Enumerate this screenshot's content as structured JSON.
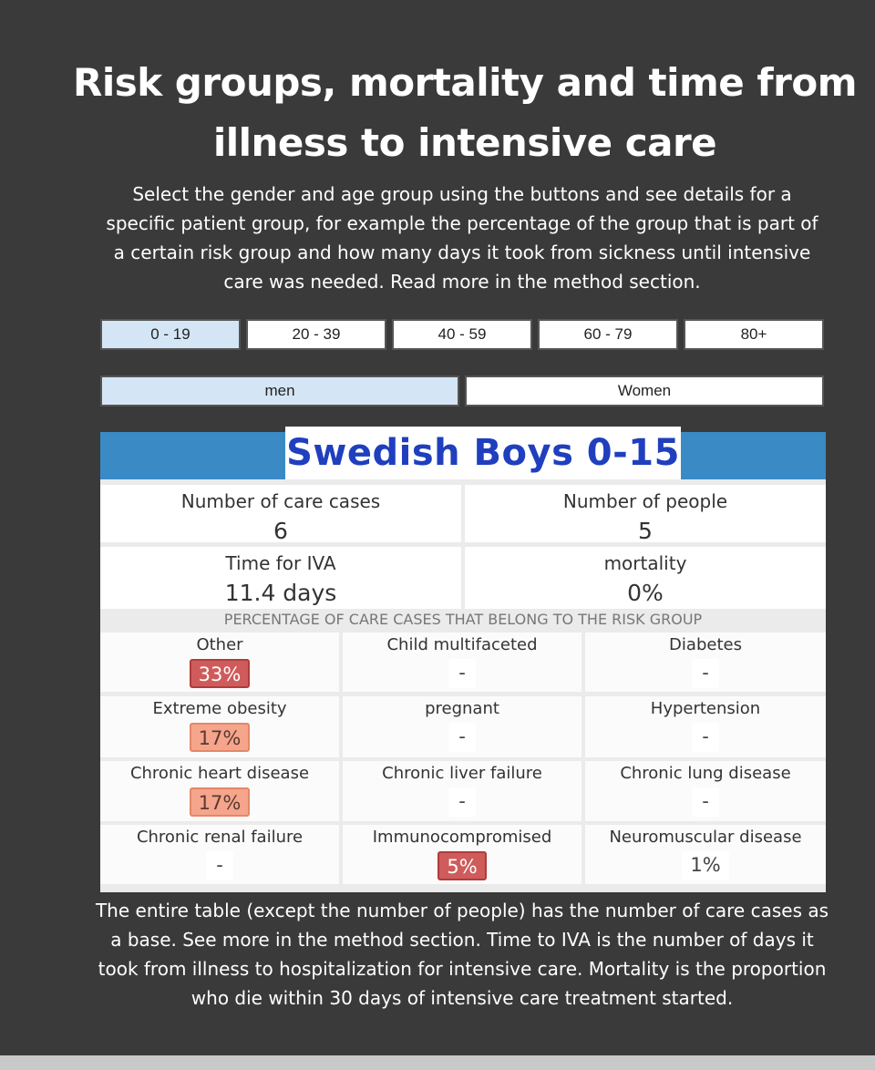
{
  "title": "Risk groups, mortality and time from illness to intensive care",
  "description": "Select the gender and age group using the buttons and see details for a specific patient group, for example the percentage of the group that is part of a certain risk group and how many days it took from sickness until intensive care was needed. Read more in the method section.",
  "age_groups": [
    "0 - 19",
    "20 - 39",
    "40 - 59",
    "60 - 79",
    "80+"
  ],
  "genders": [
    "men",
    "Women"
  ],
  "panel": {
    "title": "Swedish Boys 0-15",
    "care_cases_label": "Number of care cases",
    "care_cases_value": "6",
    "people_label": "Number of people",
    "people_value": "5",
    "iva_label": "Time for IVA",
    "iva_value": "11.4 days",
    "mortality_label": "mortality",
    "mortality_value": "0%",
    "risk_header": "Percentage of care cases that belong to the risk group",
    "risks": [
      {
        "label": "Other",
        "value": "33%",
        "level": "high"
      },
      {
        "label": "Child multifaceted",
        "value": "-",
        "level": "none"
      },
      {
        "label": "Diabetes",
        "value": "-",
        "level": "none"
      },
      {
        "label": "Extreme obesity",
        "value": "17%",
        "level": "mid"
      },
      {
        "label": "pregnant",
        "value": "-",
        "level": "none"
      },
      {
        "label": "Hypertension",
        "value": "-",
        "level": "none"
      },
      {
        "label": "Chronic heart disease",
        "value": "17%",
        "level": "mid"
      },
      {
        "label": "Chronic liver failure",
        "value": "-",
        "level": "none"
      },
      {
        "label": "Chronic lung disease",
        "value": "-",
        "level": "none"
      },
      {
        "label": "Chronic renal failure",
        "value": "-",
        "level": "none"
      },
      {
        "label": "Immunocompromised",
        "value": "5%",
        "level": "high"
      },
      {
        "label": "Neuromuscular disease",
        "value": "1%",
        "level": "low"
      }
    ]
  },
  "footer": "The entire table (except the number of people) has the number of care cases as a base. See more in the method section. Time to IVA is the number of days it took from illness to hospitalization for intensive care. Mortality is the proportion who die within 30 days of intensive care treatment started.",
  "colors": {
    "background": "#3a3a3a",
    "panel_header": "#3a8ac6",
    "title_text": "#1f3fbf",
    "selected_button": "#d4e6f5",
    "high_risk": "#cf5b5b",
    "mid_risk": "#f5a58b"
  }
}
